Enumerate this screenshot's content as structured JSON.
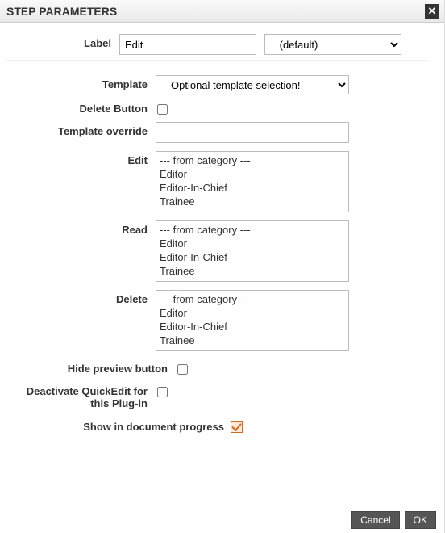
{
  "title": "STEP PARAMETERS",
  "labels": {
    "label": "Label",
    "template": "Template",
    "delete_button": "Delete Button",
    "template_override": "Template override",
    "edit": "Edit",
    "read": "Read",
    "delete": "Delete",
    "hide_preview": "Hide preview button",
    "deactivate_quickedit": "Deactivate QuickEdit for this Plug-in",
    "show_in_progress": "Show in document progress"
  },
  "fields": {
    "label_value": "Edit",
    "label_locale_selected": "(default)",
    "template_selected": "Optional template selection!",
    "template_override_value": "",
    "delete_button_checked": false,
    "hide_preview_checked": false,
    "deactivate_quickedit_checked": false,
    "show_in_progress_checked": true
  },
  "role_options": [
    "--- from category ---",
    "Editor",
    "Editor-In-Chief",
    "Trainee"
  ],
  "buttons": {
    "cancel": "Cancel",
    "ok": "OK"
  }
}
